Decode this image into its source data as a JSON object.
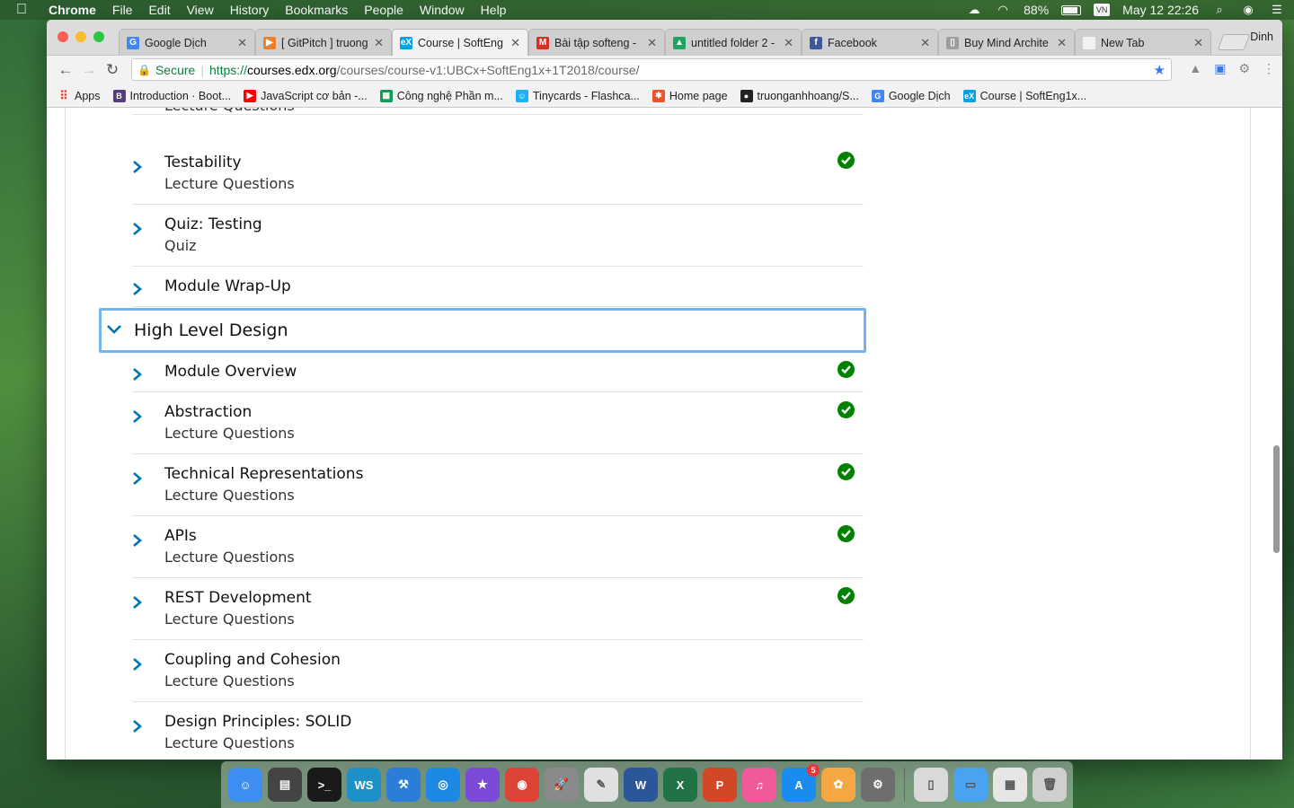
{
  "menubar": {
    "apple_icon": "apple-icon",
    "items": [
      "Chrome",
      "File",
      "Edit",
      "View",
      "History",
      "Bookmarks",
      "People",
      "Window",
      "Help"
    ],
    "battery": "88%",
    "clock": "May 12  22:26"
  },
  "browser": {
    "profile": "Dinh",
    "tabs": [
      {
        "title": "Google Dịch",
        "icon": "google-translate-icon",
        "color": "#4285f4",
        "glyph": "G"
      },
      {
        "title": "[ GitPitch ] truong",
        "icon": "gitpitch-icon",
        "color": "#e8822a",
        "glyph": "▶"
      },
      {
        "title": "Course | SoftEng",
        "icon": "edx-icon",
        "color": "#02a1e4",
        "glyph": "eX",
        "active": true
      },
      {
        "title": "Bài tập softeng -",
        "icon": "gmail-icon",
        "color": "#d93025",
        "glyph": "M"
      },
      {
        "title": "untitled folder 2 -",
        "icon": "google-drive-icon",
        "color": "#1fa463",
        "glyph": "▲"
      },
      {
        "title": "Facebook",
        "icon": "facebook-icon",
        "color": "#3b5998",
        "glyph": "f"
      },
      {
        "title": "Buy Mind Archite",
        "icon": "document-icon",
        "color": "#9e9e9e",
        "glyph": "▯"
      },
      {
        "title": "New Tab",
        "icon": "new-tab-icon",
        "color": "#f2f2f2",
        "glyph": ""
      }
    ],
    "omnibox": {
      "secure_label": "Secure",
      "scheme": "https://",
      "host": "courses.edx.org",
      "path": "/courses/course-v1:UBCx+SoftEng1x+1T2018/course/"
    },
    "bookmarks": [
      {
        "label": "Apps",
        "icon": "apps-grid-icon",
        "color": "#e94235"
      },
      {
        "label": "Introduction · Boot...",
        "icon": "bootstrap-icon",
        "color": "#563d7c",
        "glyph": "B"
      },
      {
        "label": "JavaScript cơ bản -...",
        "icon": "youtube-icon",
        "color": "#ff0000",
        "glyph": "▶"
      },
      {
        "label": "Công nghệ Phần m...",
        "icon": "sheets-icon",
        "color": "#0f9d58",
        "glyph": "▦"
      },
      {
        "label": "Tinycards - Flashca...",
        "icon": "tinycards-icon",
        "color": "#1cb0f6",
        "glyph": "☺"
      },
      {
        "label": "Home page",
        "icon": "homepage-icon",
        "color": "#e8552a",
        "glyph": "✱"
      },
      {
        "label": "truonganhhoang/S...",
        "icon": "github-icon",
        "color": "#222222",
        "glyph": "●"
      },
      {
        "label": "Google Dịch",
        "icon": "google-translate-icon",
        "color": "#4285f4",
        "glyph": "G"
      },
      {
        "label": "Course | SoftEng1x...",
        "icon": "edx-icon",
        "color": "#02a1e4",
        "glyph": "eX"
      }
    ]
  },
  "outline": {
    "top_items": [
      {
        "name": "",
        "sub": "Lecture Questions",
        "complete": false,
        "partial": true
      },
      {
        "name": "Testability",
        "sub": "Lecture Questions",
        "complete": true
      },
      {
        "name": "Quiz: Testing",
        "sub": "Quiz",
        "complete": false
      },
      {
        "name": "Module Wrap-Up",
        "sub": "",
        "complete": false
      }
    ],
    "section": {
      "title": "High Level Design",
      "expanded": true
    },
    "section_items": [
      {
        "name": "Module Overview",
        "sub": "",
        "complete": true
      },
      {
        "name": "Abstraction",
        "sub": "Lecture Questions",
        "complete": true
      },
      {
        "name": "Technical Representations",
        "sub": "Lecture Questions",
        "complete": true
      },
      {
        "name": "APIs",
        "sub": "Lecture Questions",
        "complete": true
      },
      {
        "name": "REST Development",
        "sub": "Lecture Questions",
        "complete": true
      },
      {
        "name": "Coupling and Cohesion",
        "sub": "Lecture Questions",
        "complete": false
      },
      {
        "name": "Design Principles: SOLID",
        "sub": "Lecture Questions",
        "complete": false
      }
    ]
  },
  "dock": {
    "apps": [
      {
        "name": "finder-icon",
        "color": "#3d8ef0",
        "glyph": "☺"
      },
      {
        "name": "activity-monitor-icon",
        "color": "#444444",
        "glyph": "▤"
      },
      {
        "name": "terminal-icon",
        "color": "#1a1a1a",
        "glyph": ">_"
      },
      {
        "name": "webstorm-icon",
        "color": "#1e90c8",
        "glyph": "WS"
      },
      {
        "name": "xcode-icon",
        "color": "#2b7dd8",
        "glyph": "⚒"
      },
      {
        "name": "safari-icon",
        "color": "#1e88e5",
        "glyph": "◎"
      },
      {
        "name": "imovie-star-icon",
        "color": "#7b4ad9",
        "glyph": "★"
      },
      {
        "name": "chrome-icon",
        "color": "#db4437",
        "glyph": "◉"
      },
      {
        "name": "launchpad-icon",
        "color": "#8a8a8a",
        "glyph": "🚀"
      },
      {
        "name": "textedit-icon",
        "color": "#e0e0e0",
        "glyph": "✎"
      },
      {
        "name": "word-icon",
        "color": "#2b579a",
        "glyph": "W"
      },
      {
        "name": "excel-icon",
        "color": "#217346",
        "glyph": "X"
      },
      {
        "name": "powerpoint-icon",
        "color": "#d24726",
        "glyph": "P"
      },
      {
        "name": "itunes-icon",
        "color": "#f05a9a",
        "glyph": "♫"
      },
      {
        "name": "app-store-icon",
        "color": "#1a8cf0",
        "glyph": "A",
        "badge": "5"
      },
      {
        "name": "photos-icon",
        "color": "#f4a742",
        "glyph": "✿"
      },
      {
        "name": "system-preferences-icon",
        "color": "#6e6e6e",
        "glyph": "⚙"
      }
    ],
    "stack": [
      {
        "name": "document-stack-icon",
        "color": "#d9d9d9",
        "glyph": "▯"
      },
      {
        "name": "folder-icon",
        "color": "#4aa3f0",
        "glyph": "▭"
      },
      {
        "name": "downloads-icon",
        "color": "#e6e6e6",
        "glyph": "▦"
      },
      {
        "name": "trash-icon",
        "color": "#cfcfcf",
        "glyph": "🗑"
      }
    ]
  }
}
